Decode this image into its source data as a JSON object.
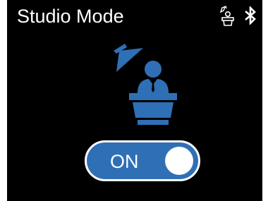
{
  "screen": {
    "title": "Studio Mode"
  },
  "status_icons": {
    "studio_icon": "speaker-podium-status-icon",
    "bluetooth_icon": "bluetooth-icon"
  },
  "illustration": {
    "icon": "speaker-at-podium-with-spotlight"
  },
  "toggle": {
    "label": "ON",
    "state": "on"
  },
  "colors": {
    "background": "#000000",
    "accent": "#2f6fb6",
    "foreground": "#ffffff"
  }
}
